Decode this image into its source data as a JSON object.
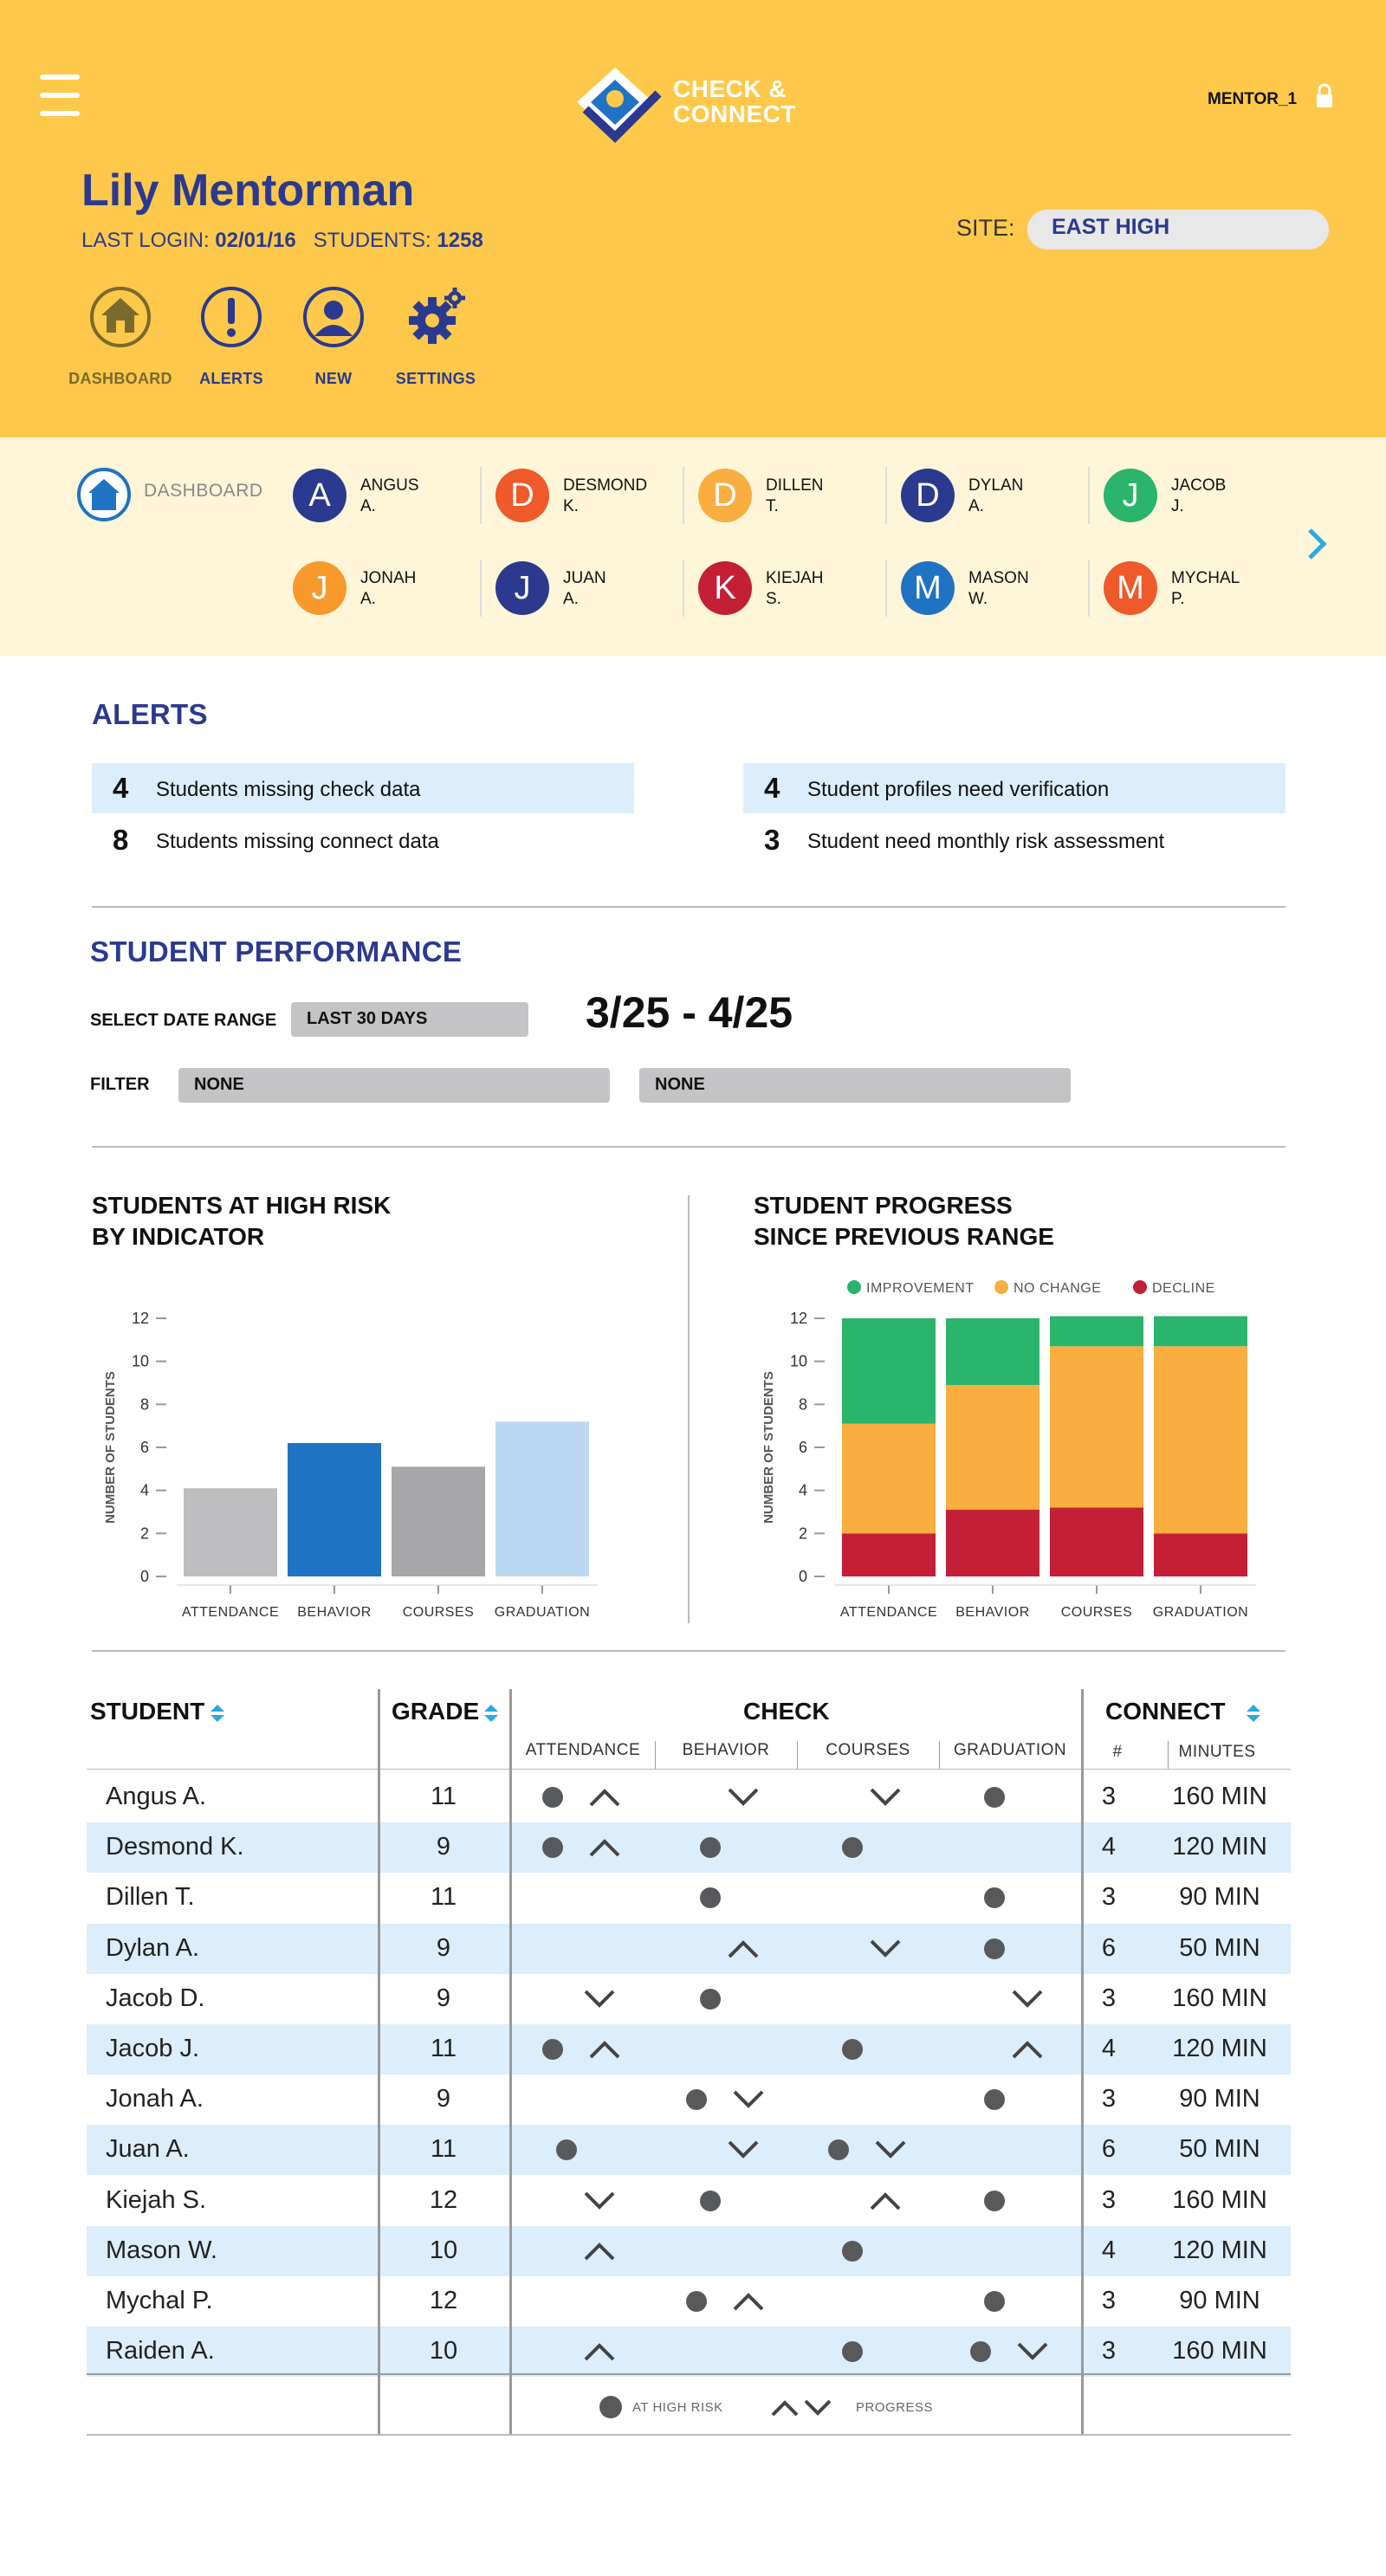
{
  "header": {
    "logo_line1": "CHECK &",
    "logo_line2": "CONNECT",
    "account": "MENTOR_1",
    "user_name": "Lily Mentorman",
    "last_login_label": "LAST LOGIN:",
    "last_login_value": "02/01/16",
    "students_label": "STUDENTS:",
    "students_value": "1258",
    "site_label": "SITE:",
    "site_value": "EAST HIGH",
    "nav": [
      {
        "label": "DASHBOARD",
        "icon": "home-icon"
      },
      {
        "label": "ALERTS",
        "icon": "alert-icon"
      },
      {
        "label": "NEW",
        "icon": "user-icon"
      },
      {
        "label": "SETTINGS",
        "icon": "gear-icon"
      }
    ]
  },
  "student_nav": {
    "dashboard_label": "DASHBOARD",
    "students": [
      {
        "initial": "A",
        "first": "ANGUS",
        "last": "A.",
        "color": "#2B3A8F"
      },
      {
        "initial": "D",
        "first": "DESMOND",
        "last": "K.",
        "color": "#EE5A2A"
      },
      {
        "initial": "D",
        "first": "DILLEN",
        "last": "T.",
        "color": "#F9AE3F"
      },
      {
        "initial": "D",
        "first": "DYLAN",
        "last": "A.",
        "color": "#2B3A8F"
      },
      {
        "initial": "J",
        "first": "JACOB",
        "last": "J.",
        "color": "#2BB46B"
      },
      {
        "initial": "J",
        "first": "JONAH",
        "last": "A.",
        "color": "#F79A2B"
      },
      {
        "initial": "J",
        "first": "JUAN",
        "last": "A.",
        "color": "#2B3A8F"
      },
      {
        "initial": "K",
        "first": "KIEJAH",
        "last": "S.",
        "color": "#C31F36"
      },
      {
        "initial": "M",
        "first": "MASON",
        "last": "W.",
        "color": "#1F73C3"
      },
      {
        "initial": "M",
        "first": "MYCHAL",
        "last": "P.",
        "color": "#EE5A2A"
      }
    ]
  },
  "alerts": {
    "title": "ALERTS",
    "items": [
      {
        "count": "4",
        "text": "Students missing check data"
      },
      {
        "count": "8",
        "text": "Students missing connect data"
      },
      {
        "count": "4",
        "text": "Student profiles need verification"
      },
      {
        "count": "3",
        "text": "Student need monthly risk assessment"
      }
    ]
  },
  "performance": {
    "title": "STUDENT PERFORMANCE",
    "date_range_label": "SELECT DATE RANGE",
    "date_range_value": "LAST 30 DAYS",
    "date_range_display": "3/25 - 4/25",
    "filter_label": "FILTER",
    "filter1_value": "NONE",
    "filter2_value": "NONE"
  },
  "chart_data": [
    {
      "type": "bar",
      "title_line1": "STUDENTS AT HIGH RISK",
      "title_line2": "BY INDICATOR",
      "ylabel": "NUMBER OF STUDENTS",
      "categories": [
        "ATTENDANCE",
        "BEHAVIOR",
        "COURSES",
        "GRADUATION"
      ],
      "values": [
        4.1,
        6.2,
        5.1,
        7.2
      ],
      "colors": [
        "#BDBDBF",
        "#1F73C3",
        "#A6A6A8",
        "#BCD8F2"
      ],
      "yticks": [
        "0",
        "2",
        "4",
        "6",
        "8",
        "10",
        "12"
      ],
      "ylim": [
        0,
        12
      ]
    },
    {
      "type": "bar",
      "stacked": true,
      "title_line1": "STUDENT PROGRESS",
      "title_line2": "SINCE PREVIOUS RANGE",
      "ylabel": "NUMBER OF STUDENTS",
      "categories": [
        "ATTENDANCE",
        "BEHAVIOR",
        "COURSES",
        "GRADUATION"
      ],
      "series": [
        {
          "name": "DECLINE",
          "color": "#C31F36",
          "values": [
            2,
            3.1,
            3.2,
            2
          ]
        },
        {
          "name": "NO CHANGE",
          "color": "#F9AE3F",
          "values": [
            5.1,
            5.8,
            7.5,
            8.7
          ]
        },
        {
          "name": "IMPROVEMENT",
          "color": "#2BB46B",
          "values": [
            4.9,
            3.1,
            1.4,
            1.4
          ]
        }
      ],
      "legend": [
        "IMPROVEMENT",
        "NO CHANGE",
        "DECLINE"
      ],
      "legend_colors": [
        "#2BB46B",
        "#F9AE3F",
        "#C31F36"
      ],
      "yticks": [
        "0",
        "2",
        "4",
        "6",
        "8",
        "10",
        "12"
      ],
      "ylim": [
        0,
        12
      ]
    }
  ],
  "table": {
    "headers": {
      "student": "STUDENT",
      "grade": "GRADE",
      "check": "CHECK",
      "connect": "CONNECT",
      "attendance": "ATTENDANCE",
      "behavior": "BEHAVIOR",
      "courses": "COURSES",
      "graduation": "GRADUATION",
      "num": "#",
      "minutes": "MINUTES"
    },
    "rows": [
      {
        "name": "Angus A.",
        "grade": "11",
        "att": [
          "dot",
          "up"
        ],
        "beh": [
          "down"
        ],
        "cou": [
          "down"
        ],
        "gra": [
          "dot"
        ],
        "num": "3",
        "min": "160 MIN"
      },
      {
        "name": "Desmond K.",
        "grade": "9",
        "att": [
          "dot",
          "up"
        ],
        "beh": [
          "dot"
        ],
        "cou": [
          "dot"
        ],
        "gra": [],
        "num": "4",
        "min": "120 MIN"
      },
      {
        "name": "Dillen T.",
        "grade": "11",
        "att": [],
        "beh": [
          "dot"
        ],
        "cou": [],
        "gra": [
          "dot"
        ],
        "num": "3",
        "min": "90 MIN"
      },
      {
        "name": "Dylan A.",
        "grade": "9",
        "att": [],
        "beh": [
          "up"
        ],
        "cou": [
          "down"
        ],
        "gra": [
          "dot"
        ],
        "num": "6",
        "min": "50 MIN"
      },
      {
        "name": "Jacob D.",
        "grade": "9",
        "att": [
          "down"
        ],
        "beh": [
          "dot"
        ],
        "cou": [],
        "gra": [
          "down"
        ],
        "num": "3",
        "min": "160 MIN"
      },
      {
        "name": "Jacob J.",
        "grade": "11",
        "att": [
          "dot",
          "up"
        ],
        "beh": [],
        "cou": [
          "dot"
        ],
        "gra": [
          "up"
        ],
        "num": "4",
        "min": "120 MIN"
      },
      {
        "name": "Jonah A.",
        "grade": "9",
        "att": [],
        "beh": [
          "dot",
          "down"
        ],
        "cou": [],
        "gra": [
          "dot"
        ],
        "num": "3",
        "min": "90 MIN"
      },
      {
        "name": "Juan A.",
        "grade": "11",
        "att": [
          "dot"
        ],
        "beh": [
          "down"
        ],
        "cou": [
          "dot",
          "down"
        ],
        "gra": [],
        "num": "6",
        "min": "50 MIN"
      },
      {
        "name": "Kiejah S.",
        "grade": "12",
        "att": [
          "down"
        ],
        "beh": [
          "dot"
        ],
        "cou": [
          "up"
        ],
        "gra": [
          "dot"
        ],
        "num": "3",
        "min": "160 MIN"
      },
      {
        "name": "Mason W.",
        "grade": "10",
        "att": [
          "up"
        ],
        "beh": [],
        "cou": [
          "dot"
        ],
        "gra": [],
        "num": "4",
        "min": "120 MIN"
      },
      {
        "name": "Mychal P.",
        "grade": "12",
        "att": [],
        "beh": [
          "dot",
          "up"
        ],
        "cou": [],
        "gra": [
          "dot"
        ],
        "num": "3",
        "min": "90 MIN"
      },
      {
        "name": "Raiden A.",
        "grade": "10",
        "att": [
          "up"
        ],
        "beh": [],
        "cou": [
          "dot"
        ],
        "gra": [
          "dot",
          "down"
        ],
        "num": "3",
        "min": "160 MIN"
      }
    ],
    "legend_high_risk": "AT HIGH RISK",
    "legend_progress": "PROGRESS"
  },
  "colors": {
    "header_bg": "#FEC94A",
    "nav_bg": "#FFF5D8",
    "accent_blue": "#2B3A8F",
    "row_highlight": "#DCEEFB",
    "sort_arrow": "#29A9E1"
  }
}
